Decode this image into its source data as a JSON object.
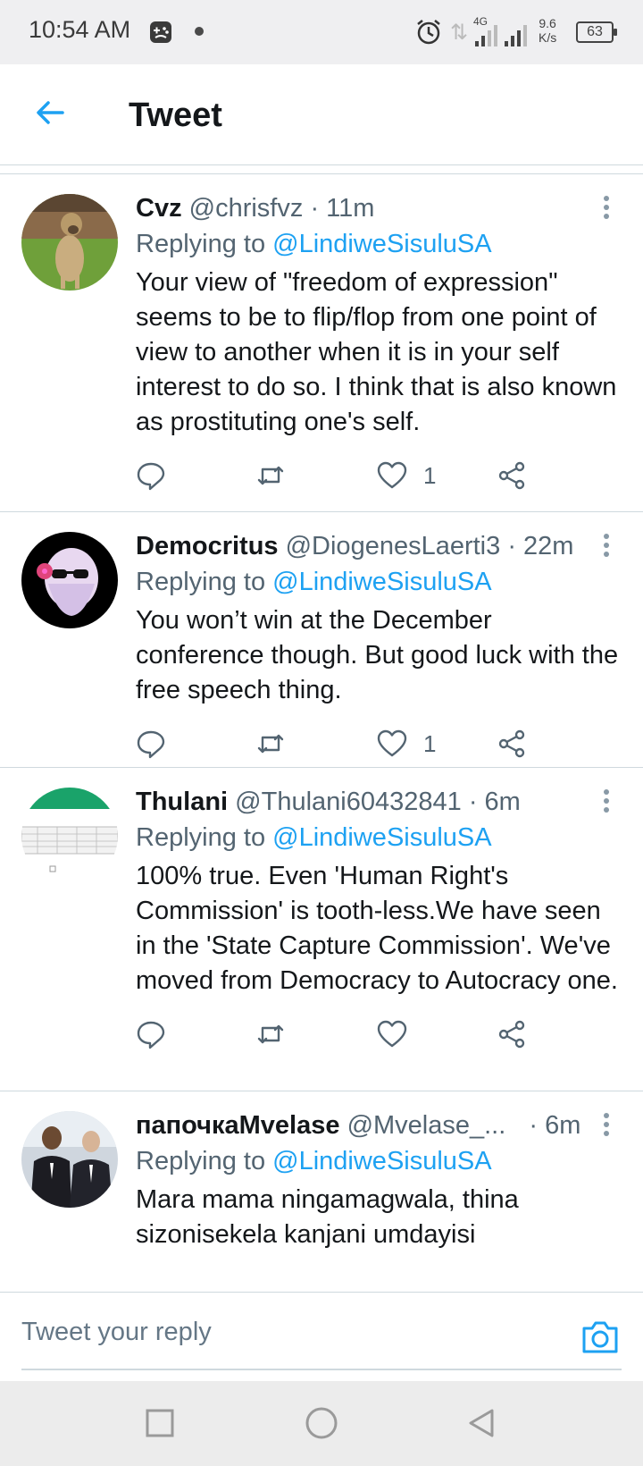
{
  "status_bar": {
    "time": "10:54 AM",
    "network_type": "4G",
    "net_speed_value": "9.6",
    "net_speed_unit": "K/s",
    "battery": "63",
    "icons": [
      "game-controller-icon",
      "alarm-icon",
      "data-arrows-icon",
      "signal-icon",
      "battery-icon"
    ]
  },
  "header": {
    "title": "Tweet",
    "back_icon": "arrow-left-icon"
  },
  "colors": {
    "accent": "#1da1f2",
    "text_primary": "#14171a",
    "text_secondary": "#536471",
    "divider": "#cfd9de"
  },
  "tweets": [
    {
      "name": "Cvz",
      "handle": "@chrisfvz",
      "time": "· 11m",
      "replying_prefix": "Replying to",
      "replying_to": "@LindiweSisuluSA",
      "text": "Your view of \"freedom of expression\" seems to be to flip/flop from one point of view to another when it is in your self interest to do so. I think that is also known as prostituting one's self.",
      "likes": "1"
    },
    {
      "name": "Democritus",
      "handle": "@DiogenesLaerti3",
      "time": "· 22m",
      "replying_prefix": "Replying to",
      "replying_to": "@LindiweSisuluSA",
      "text": "You won’t win at the December conference though. But good luck with the free speech thing.",
      "likes": "1"
    },
    {
      "name": "Thulani",
      "handle": "@Thulani60432841",
      "time": "· 6m",
      "replying_prefix": "Replying to",
      "replying_to": "@LindiweSisuluSA",
      "text": "100% true. Even 'Human Right's Commission' is tooth-less.We have seen in the 'State Capture Commission'. We've moved from Democracy to Autocracy one.",
      "likes": ""
    },
    {
      "name": "папочкаMvelase",
      "handle": "@Mvelase_...",
      "time": "· 6m",
      "replying_prefix": "Replying to",
      "replying_to": "@LindiweSisuluSA",
      "text": "Mara mama ningamagwala, thina sizonisekela kanjani umdayisi",
      "likes": ""
    }
  ],
  "composer": {
    "placeholder": "Tweet your reply",
    "camera_icon": "camera-icon"
  },
  "nav_bar": {
    "buttons": [
      "recent-apps-icon",
      "home-icon",
      "back-icon"
    ]
  }
}
